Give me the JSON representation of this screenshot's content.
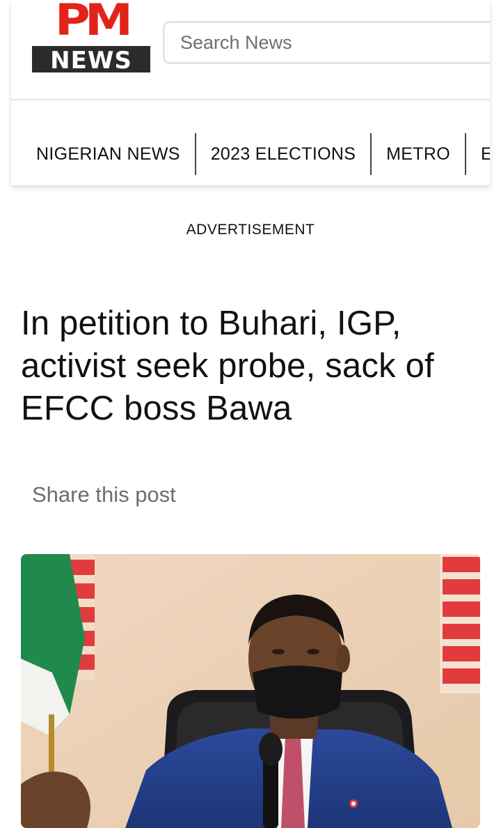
{
  "header": {
    "logo": {
      "top_text": "PM",
      "bottom_text": "NEWS"
    },
    "search": {
      "placeholder": "Search News"
    }
  },
  "nav": {
    "items": [
      {
        "label": "NIGERIAN NEWS"
      },
      {
        "label": "2023 ELECTIONS"
      },
      {
        "label": "METRO"
      },
      {
        "label": "EN"
      }
    ]
  },
  "advertisement_label": "ADVERTISEMENT",
  "article": {
    "headline": "In petition to Buhari, IGP, activist seek probe, sack of EFCC boss Bawa",
    "share_label": "Share this post"
  },
  "colors": {
    "brand_red": "#e2231a",
    "logo_dark": "#2b2b2b",
    "muted_text": "#6d6d6d"
  }
}
